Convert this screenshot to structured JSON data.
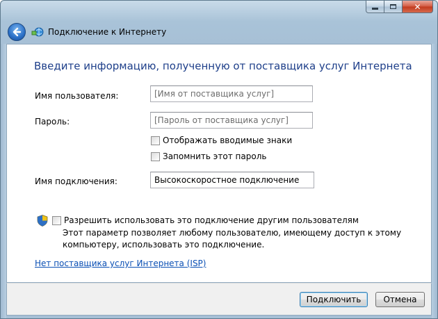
{
  "window": {
    "nav_title": "Подключение к Интернету"
  },
  "form": {
    "heading": "Введите информацию, полученную от поставщика услуг Интернета",
    "username": {
      "label": "Имя пользователя:",
      "placeholder": "[Имя от поставщика услуг]",
      "value": ""
    },
    "password": {
      "label": "Пароль:",
      "placeholder": "[Пароль от поставщика услуг]",
      "value": ""
    },
    "show_chars": {
      "label": "Отображать вводимые знаки",
      "checked": false
    },
    "remember_password": {
      "label": "Запомнить этот пароль",
      "checked": false
    },
    "connection_name": {
      "label": "Имя подключения:",
      "value": "Высокоскоростное подключение"
    },
    "allow_others": {
      "label": "Разрешить использовать это подключение другим пользователям",
      "checked": false,
      "description": "Этот параметр позволяет любому пользователю, имеющему доступ к этому компьютеру, использовать это подключение."
    },
    "no_isp_link": "Нет поставщика услуг Интернета (ISP)"
  },
  "buttons": {
    "connect": "Подключить",
    "cancel": "Отмена"
  },
  "icons": {
    "back": "back-arrow-icon",
    "network": "network-connection-icon",
    "shield": "uac-shield-icon",
    "minimize": "minimize-icon",
    "maximize": "maximize-icon",
    "close": "close-icon"
  },
  "colors": {
    "heading": "#1e3f8a",
    "link": "#0a4fb4",
    "frame": "#a7c0d6",
    "close": "#c13a1d"
  }
}
